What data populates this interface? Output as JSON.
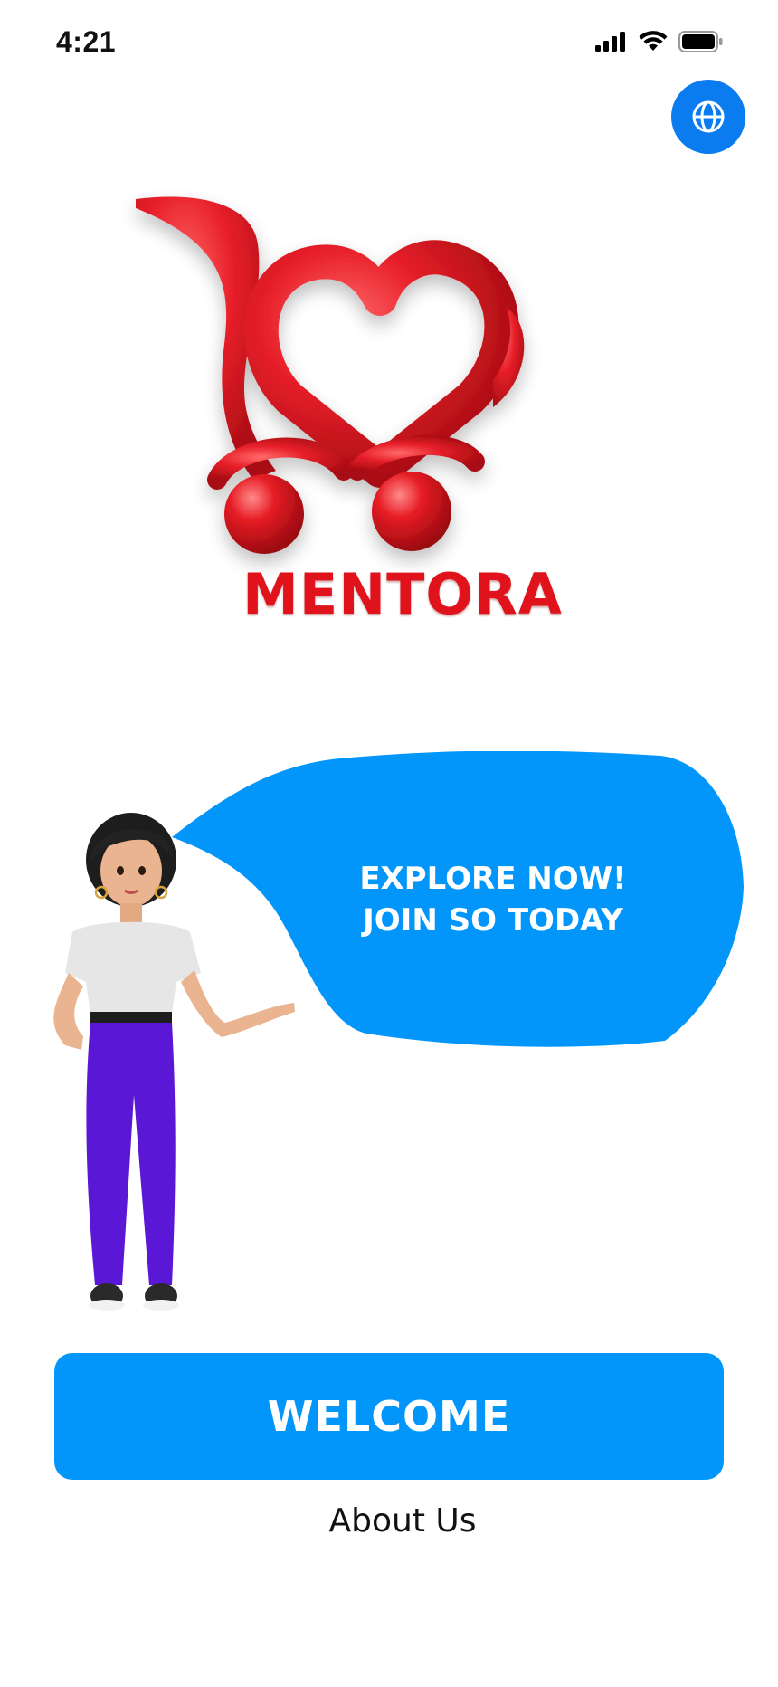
{
  "status_bar": {
    "time": "4:21",
    "icons": [
      "cellular-signal-icon",
      "wifi-icon",
      "battery-icon"
    ]
  },
  "language_button": {
    "icon": "globe-icon",
    "color": "#0A7CF0"
  },
  "brand": {
    "name": "MENTORA",
    "color": "#E0121B",
    "logo_icon": "heart-shopping-cart-icon"
  },
  "promo_bubble": {
    "line1": "EXPLORE NOW!",
    "line2": "JOIN SO TODAY",
    "color": "#0396FA"
  },
  "welcome_button": {
    "label": "WELCOME",
    "color": "#0396FA"
  },
  "about_link": {
    "label": "About Us"
  }
}
